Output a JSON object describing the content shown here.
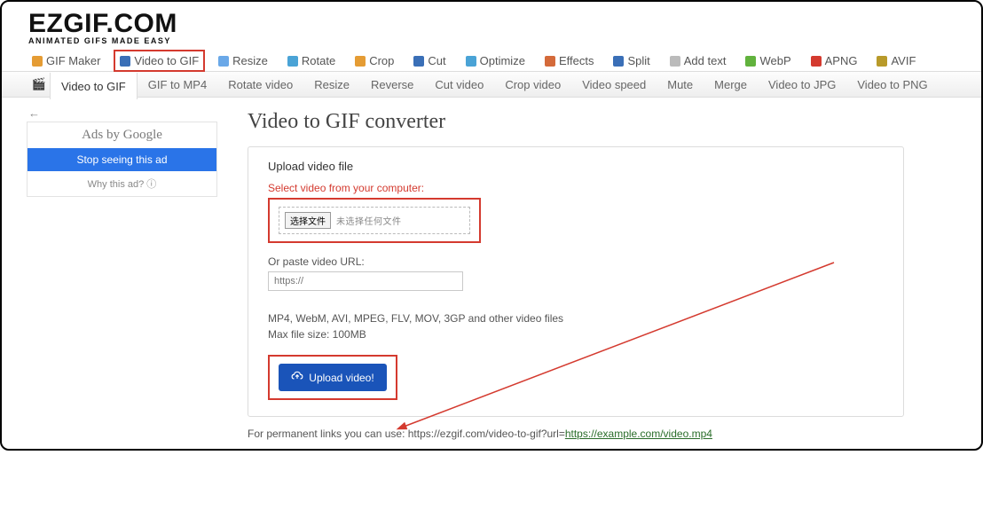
{
  "logo": {
    "title": "EZGIF.COM",
    "tagline": "ANIMATED GIFS MADE EASY"
  },
  "topnav": {
    "items": [
      {
        "label": "GIF Maker",
        "icon": "#e59c34"
      },
      {
        "label": "Video to GIF",
        "icon": "#3a6fb7",
        "highlight": true
      },
      {
        "label": "Resize",
        "icon": "#6aa8e8"
      },
      {
        "label": "Rotate",
        "icon": "#4aa3d6"
      },
      {
        "label": "Crop",
        "icon": "#e59c34"
      },
      {
        "label": "Cut",
        "icon": "#3a6fb7"
      },
      {
        "label": "Optimize",
        "icon": "#4aa3d6"
      },
      {
        "label": "Effects",
        "icon": "#d46a3a"
      },
      {
        "label": "Split",
        "icon": "#3a6fb7"
      },
      {
        "label": "Add text",
        "icon": "#bbb"
      },
      {
        "label": "WebP",
        "icon": "#61b23d"
      },
      {
        "label": "APNG",
        "icon": "#d43a2f"
      },
      {
        "label": "AVIF",
        "icon": "#b89a2a"
      }
    ]
  },
  "subnav": {
    "items": [
      "Video to GIF",
      "GIF to MP4",
      "Rotate video",
      "Resize",
      "Reverse",
      "Cut video",
      "Crop video",
      "Video speed",
      "Mute",
      "Merge",
      "Video to JPG",
      "Video to PNG"
    ],
    "activeIndex": 0
  },
  "sidebar": {
    "ads_title": "Ads by Google",
    "stop_label": "Stop seeing this ad",
    "why_label": "Why this ad? ⓘ",
    "back_arrow": "←"
  },
  "main": {
    "heading": "Video to GIF converter",
    "upload_section_label": "Upload video file",
    "select_label": "Select video from your computer:",
    "file_button": "选择文件",
    "file_status": "未选择任何文件",
    "paste_label": "Or paste video URL:",
    "url_placeholder": "https://",
    "formats_line1": "MP4, WebM, AVI, MPEG, FLV, MOV, 3GP and other video files",
    "formats_line2": "Max file size: 100MB",
    "upload_button": "Upload video!",
    "permalink_prefix": "For permanent links you can use: https://ezgif.com/video-to-gif?url=",
    "permalink_example": "https://example.com/video.mp4"
  }
}
